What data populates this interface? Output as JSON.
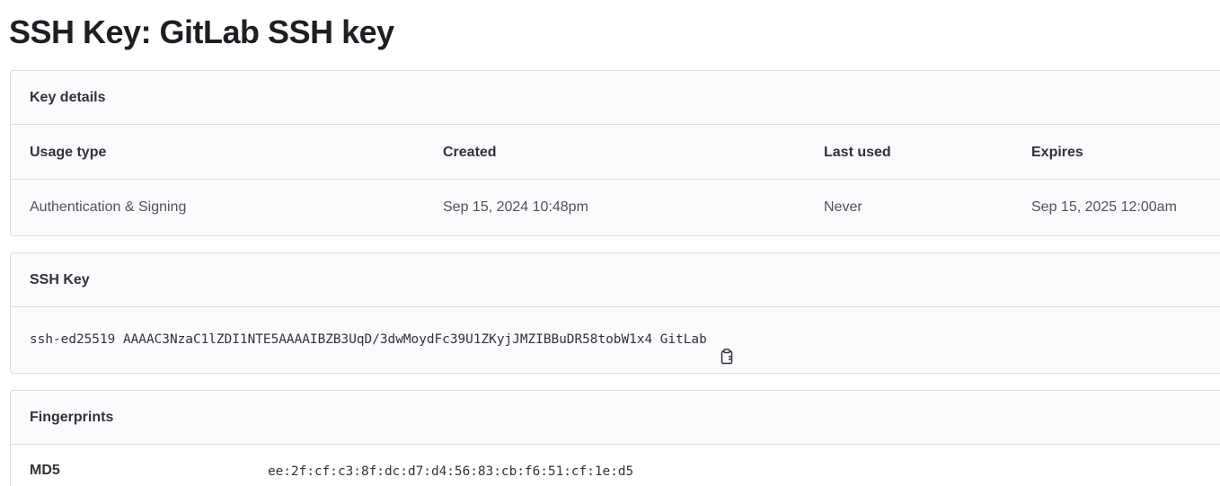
{
  "page": {
    "title": "SSH Key: GitLab SSH key"
  },
  "details": {
    "header": "Key details",
    "columns": {
      "usage_type": "Usage type",
      "created": "Created",
      "last_used": "Last used",
      "expires": "Expires"
    },
    "values": {
      "usage_type": "Authentication & Signing",
      "created": "Sep 15, 2024 10:48pm",
      "last_used": "Never",
      "expires": "Sep 15, 2025 12:00am"
    }
  },
  "ssh_key": {
    "header": "SSH Key",
    "value": "ssh-ed25519 AAAAC3NzaC1lZDI1NTE5AAAAIBZB3UqD/3dwMoydFc39U1ZKyjJMZIBBuDR58tobW1x4 GitLab",
    "copy_icon": "clipboard-icon"
  },
  "fingerprints": {
    "header": "Fingerprints",
    "rows": [
      {
        "label": "MD5",
        "value": "ee:2f:cf:c3:8f:dc:d7:d4:56:83:cb:f6:51:cf:1e:d5"
      }
    ]
  },
  "colors": {
    "border": "#dcdcde",
    "header_bg": "#fbfafd",
    "text": "#333238",
    "muted_text": "#535158"
  }
}
